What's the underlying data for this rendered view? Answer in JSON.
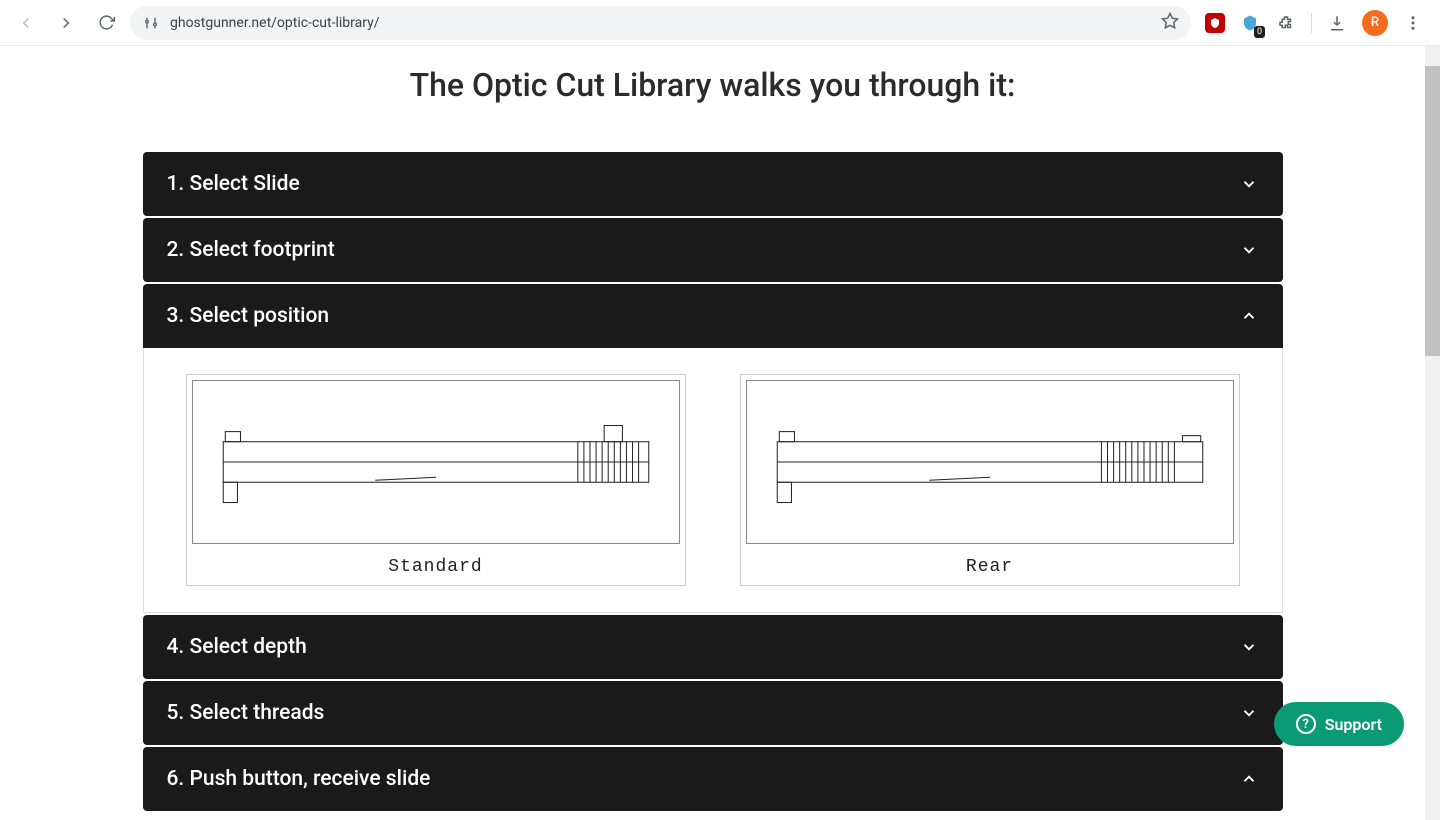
{
  "browser": {
    "url": "ghostgunner.net/optic-cut-library/",
    "avatar_letter": "R",
    "badge_count": "0"
  },
  "page": {
    "title": "The Optic Cut Library walks you through it:"
  },
  "accordion": {
    "items": [
      {
        "label": "1. Select Slide",
        "expanded": false
      },
      {
        "label": "2. Select footprint",
        "expanded": false
      },
      {
        "label": "3. Select position",
        "expanded": true
      },
      {
        "label": "4. Select depth",
        "expanded": false
      },
      {
        "label": "5. Select threads",
        "expanded": false
      },
      {
        "label": "6. Push button, receive slide",
        "expanded": true
      }
    ]
  },
  "position_options": {
    "left": "Standard",
    "right": "Rear"
  },
  "support": {
    "label": "Support"
  }
}
